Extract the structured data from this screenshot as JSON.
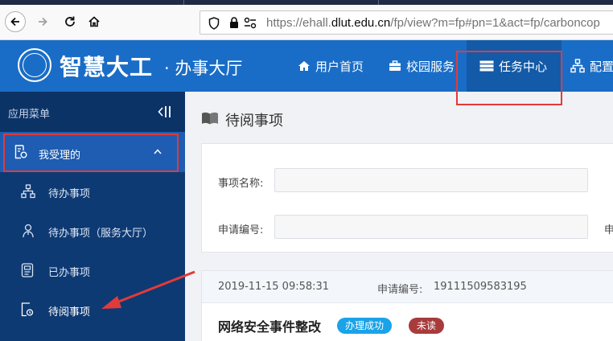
{
  "browser": {
    "url_prefix": "https://ehall.",
    "url_domain": "dlut.edu.cn",
    "url_suffix": "/fp/view?m=fp#pn=1&act=fp/carboncop"
  },
  "header": {
    "logo_title": "智慧大工",
    "logo_subtitle": "· 办事大厅",
    "nav": [
      {
        "label": "用户首页",
        "icon": "home-icon"
      },
      {
        "label": "校园服务",
        "icon": "briefcase-icon"
      },
      {
        "label": "任务中心",
        "icon": "server-icon",
        "active": true
      },
      {
        "label": "配置",
        "icon": "sitemap-icon"
      }
    ]
  },
  "sidebar": {
    "header_label": "应用菜单",
    "parent_label": "我受理的",
    "items": [
      {
        "label": "待办事项",
        "icon": "sitemap-icon"
      },
      {
        "label": "待办事项（服务大厅）",
        "icon": "user-tree-icon"
      },
      {
        "label": "已办事项",
        "icon": "document-icon"
      },
      {
        "label": "待阅事项",
        "icon": "read-icon",
        "active": true
      }
    ]
  },
  "main": {
    "title": "待阅事项",
    "filters": {
      "name_label": "事项名称:",
      "number_label": "申请编号:",
      "extra_label": "申"
    },
    "task": {
      "time": "2019-11-15 09:58:31",
      "number_label": "申请编号:",
      "number": "19111509583195",
      "name": "网络安全事件整改",
      "status": "办理成功",
      "read_state": "未读"
    }
  },
  "colors": {
    "header_blue": "#1a6dc6",
    "sidebar_blue": "#0e3a73",
    "badge_success": "#1aa3e8",
    "badge_unread": "#a83b3b",
    "annotation_red": "#e33a3a"
  }
}
